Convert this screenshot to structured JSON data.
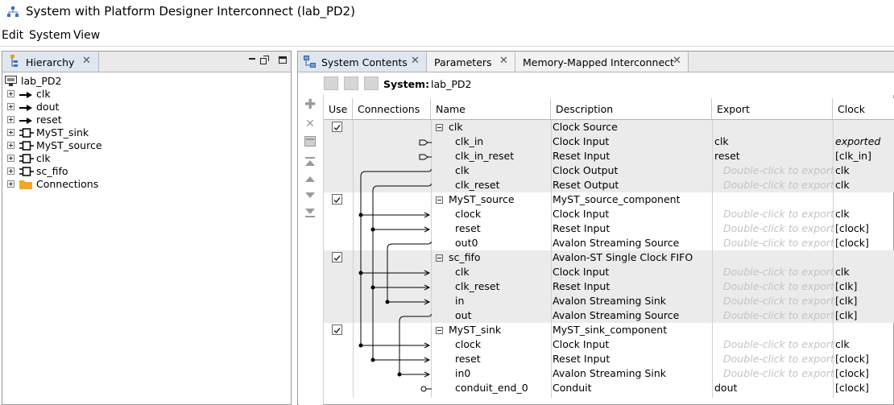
{
  "window": {
    "title": "System with Platform Designer Interconnect (lab_PD2)"
  },
  "menu": {
    "items": [
      "Edit",
      "System",
      "View"
    ]
  },
  "hierarchy": {
    "tab_label": "Hierarchy",
    "root": "lab_PD2",
    "items": [
      {
        "label": "clk",
        "icon": "clock-port-icon"
      },
      {
        "label": "dout",
        "icon": "conduit-port-icon"
      },
      {
        "label": "reset",
        "icon": "reset-port-icon"
      },
      {
        "label": "MyST_sink",
        "icon": "component-icon"
      },
      {
        "label": "MyST_source",
        "icon": "component-icon"
      },
      {
        "label": "clk",
        "icon": "component-icon"
      },
      {
        "label": "sc_fifo",
        "icon": "component-icon"
      },
      {
        "label": "Connections",
        "icon": "folder-icon"
      }
    ]
  },
  "tabs": [
    {
      "label": "System Contents",
      "active": true
    },
    {
      "label": "Parameters",
      "active": false
    },
    {
      "label": "Memory-Mapped Interconnect",
      "active": false
    }
  ],
  "system": {
    "label": "System:",
    "name": "lab_PD2"
  },
  "table": {
    "headers": [
      "Use",
      "Connections",
      "Name",
      "Description",
      "Export",
      "Clock"
    ],
    "rows": [
      {
        "type": "comp",
        "use": true,
        "name": "clk",
        "desc": "Clock Source",
        "export": "",
        "clock": ""
      },
      {
        "type": "port",
        "name": "clk_in",
        "desc": "Clock Input",
        "export": "clk",
        "clock": "exported"
      },
      {
        "type": "port",
        "name": "clk_in_reset",
        "desc": "Reset Input",
        "export": "reset",
        "clock": "[clk_in]"
      },
      {
        "type": "port",
        "name": "clk",
        "desc": "Clock Output",
        "export": "Double-click to export",
        "clock": "clk"
      },
      {
        "type": "port",
        "name": "clk_reset",
        "desc": "Reset Output",
        "export": "Double-click to export",
        "clock": "clk"
      },
      {
        "type": "comp",
        "use": true,
        "name": "MyST_source",
        "desc": "MyST_source_component",
        "export": "",
        "clock": ""
      },
      {
        "type": "port",
        "name": "clock",
        "desc": "Clock Input",
        "export": "Double-click to export",
        "clock": "clk"
      },
      {
        "type": "port",
        "name": "reset",
        "desc": "Reset Input",
        "export": "Double-click to export",
        "clock": "[clock]"
      },
      {
        "type": "port",
        "name": "out0",
        "desc": "Avalon Streaming Source",
        "export": "Double-click to export",
        "clock": "[clock]"
      },
      {
        "type": "comp",
        "use": true,
        "name": "sc_fifo",
        "desc": "Avalon-ST Single Clock FIFO",
        "export": "",
        "clock": ""
      },
      {
        "type": "port",
        "name": "clk",
        "desc": "Clock Input",
        "export": "Double-click to export",
        "clock": "clk"
      },
      {
        "type": "port",
        "name": "clk_reset",
        "desc": "Reset Input",
        "export": "Double-click to export",
        "clock": "[clk]"
      },
      {
        "type": "port",
        "name": "in",
        "desc": "Avalon Streaming Sink",
        "export": "Double-click to export",
        "clock": "[clk]"
      },
      {
        "type": "port",
        "name": "out",
        "desc": "Avalon Streaming Source",
        "export": "Double-click to export",
        "clock": "[clk]"
      },
      {
        "type": "comp",
        "use": true,
        "name": "MyST_sink",
        "desc": "MyST_sink_component",
        "export": "",
        "clock": ""
      },
      {
        "type": "port",
        "name": "clock",
        "desc": "Clock Input",
        "export": "Double-click to export",
        "clock": "clk"
      },
      {
        "type": "port",
        "name": "reset",
        "desc": "Reset Input",
        "export": "Double-click to export",
        "clock": "[clock]"
      },
      {
        "type": "port",
        "name": "in0",
        "desc": "Avalon Streaming Sink",
        "export": "Double-click to export",
        "clock": "[clock]"
      },
      {
        "type": "port",
        "name": "conduit_end_0",
        "desc": "Conduit",
        "export": "dout",
        "clock": "[clock]"
      }
    ]
  }
}
